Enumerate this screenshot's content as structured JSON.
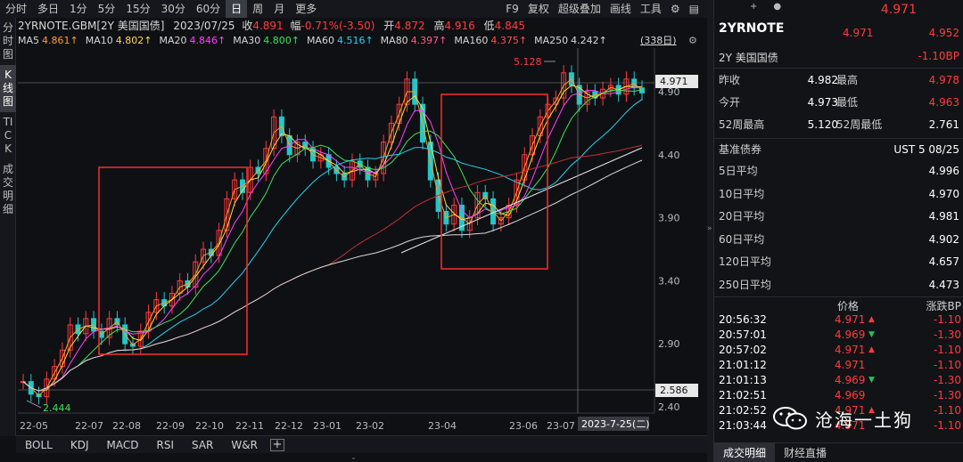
{
  "left_tabs": [
    "分时图",
    "K线图",
    "TICK",
    "成交明细"
  ],
  "timeframes": [
    "分时",
    "多日",
    "1分",
    "5分",
    "15分",
    "30分",
    "60分",
    "日",
    "周",
    "月",
    "更多"
  ],
  "active_timeframe": "日",
  "top_right": [
    "F9",
    "复权",
    "超级叠加",
    "画线",
    "工具"
  ],
  "info": {
    "symbol": "2YRNOTE.GBM[2Y 美国国债]",
    "date": "2023/07/25",
    "close_label": "收",
    "close": "4.891",
    "change_label": "幅",
    "change": "-0.71%(-3.50)",
    "open_label": "开",
    "open": "4.872",
    "high_label": "高",
    "high": "4.916",
    "low_label": "低",
    "low": "4.845"
  },
  "ma_line": [
    {
      "label": "MA5",
      "value": "4.861↑",
      "color": "#ff9c2a"
    },
    {
      "label": "MA10",
      "value": "4.802↑",
      "color": "#ffd84a"
    },
    {
      "label": "MA20",
      "value": "4.846↑",
      "color": "#ff40ff"
    },
    {
      "label": "MA30",
      "value": "4.800↑",
      "color": "#40e05a"
    },
    {
      "label": "MA60",
      "value": "4.516↑",
      "color": "#22d3ee"
    },
    {
      "label": "MA80",
      "value": "4.397↑",
      "color": "#ff5a8a"
    },
    {
      "label": "MA160",
      "value": "4.375↑",
      "color": "#ff4d4d"
    },
    {
      "label": "MA250",
      "value": "4.242↑",
      "color": "#d8d8d8"
    }
  ],
  "bars_count": "(338日)",
  "chart_data": {
    "type": "candlestick",
    "y_ticks": [
      "4.90",
      "4.40",
      "3.90",
      "3.40",
      "2.90",
      "2.40"
    ],
    "x_ticks": [
      "22-05",
      "22-07",
      "22-08",
      "22-09",
      "22-10",
      "22-11",
      "22-12",
      "23-01",
      "23-02",
      "23-04",
      "23-06",
      "23-07"
    ],
    "cursor_date": "2023-7-25(二)",
    "cursor_price": "4.971",
    "low_marker": "2.586",
    "high_annotation": "5.128",
    "low_annotation": "2.444",
    "close_series": [
      2.6,
      2.5,
      2.48,
      2.62,
      2.72,
      2.85,
      3.05,
      2.98,
      3.1,
      3.0,
      2.95,
      3.1,
      3.05,
      2.9,
      2.88,
      3.0,
      3.15,
      3.25,
      3.2,
      3.3,
      3.4,
      3.35,
      3.55,
      3.65,
      3.6,
      3.8,
      4.05,
      4.2,
      4.1,
      4.3,
      4.25,
      4.45,
      4.7,
      4.55,
      4.4,
      4.5,
      4.45,
      4.35,
      4.4,
      4.3,
      4.25,
      4.2,
      4.35,
      4.3,
      4.2,
      4.25,
      4.5,
      4.65,
      4.8,
      5.0,
      4.8,
      4.5,
      4.2,
      3.95,
      3.85,
      4.0,
      3.8,
      3.9,
      4.1,
      4.05,
      3.85,
      3.9,
      4.0,
      4.2,
      4.4,
      4.55,
      4.7,
      4.8,
      4.85,
      5.05,
      4.95,
      4.8,
      4.9,
      4.85,
      4.92,
      4.95,
      4.88,
      5.0,
      4.93,
      4.89
    ]
  },
  "panel": {
    "price_big": "4.971",
    "name": "2YRNOTE",
    "price": "4.971",
    "price2": "4.952",
    "sub": "2Y 美国国债",
    "bp": "-1.10BP",
    "quotes": [
      {
        "l1": "昨收",
        "v1": "4.982",
        "l2": "最高",
        "v2": "4.978"
      },
      {
        "l1": "今开",
        "v1": "4.973",
        "l2": "最低",
        "v2": "4.963"
      },
      {
        "l1": "52周最高",
        "v1": "5.120",
        "l2": "52周最低",
        "v2": "2.761"
      }
    ],
    "bench_label": "基准债券",
    "bench_value": "UST 5 08/25",
    "averages": [
      {
        "label": "5日平均",
        "value": "4.996"
      },
      {
        "label": "10日平均",
        "value": "4.970"
      },
      {
        "label": "20日平均",
        "value": "4.981"
      },
      {
        "label": "60日平均",
        "value": "4.902"
      },
      {
        "label": "120日平均",
        "value": "4.657"
      },
      {
        "label": "250日平均",
        "value": "4.473"
      }
    ],
    "trade_head_price": "价格",
    "trade_head_bp": "涨跌BP",
    "trades": [
      {
        "time": "20:56:32",
        "price": "4.971",
        "dir": "up",
        "bp": "-1.10"
      },
      {
        "time": "20:57:01",
        "price": "4.969",
        "dir": "down",
        "bp": "-1.30"
      },
      {
        "time": "20:57:02",
        "price": "4.971",
        "dir": "up",
        "bp": "-1.10"
      },
      {
        "time": "21:01:12",
        "price": "4.971",
        "dir": "",
        "bp": "-1.10"
      },
      {
        "time": "21:01:13",
        "price": "4.969",
        "dir": "down",
        "bp": "-1.30"
      },
      {
        "time": "21:02:51",
        "price": "4.969",
        "dir": "",
        "bp": "-1.30"
      },
      {
        "time": "21:02:52",
        "price": "4.971",
        "dir": "up",
        "bp": "-1.10"
      },
      {
        "time": "21:03:44",
        "price": "4.971",
        "dir": "",
        "bp": "-1.10"
      }
    ],
    "tabs": [
      "成交明细",
      "财经直播"
    ]
  },
  "bottom_tabs": [
    "BOLL",
    "KDJ",
    "MACD",
    "RSI",
    "SAR",
    "W&R"
  ],
  "watermark": "沧海一土狗"
}
